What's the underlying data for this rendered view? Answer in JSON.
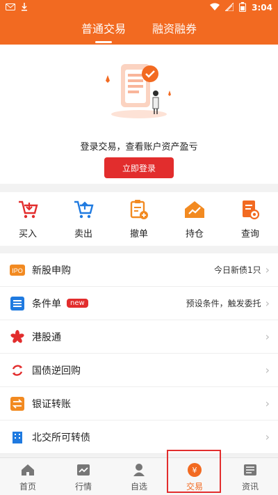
{
  "status": {
    "time": "3:04"
  },
  "tabs": [
    {
      "label": "普通交易"
    },
    {
      "label": "融资融券"
    }
  ],
  "login": {
    "message": "登录交易，查看账户资产盈亏",
    "button": "立即登录"
  },
  "actions": [
    {
      "label": "买入",
      "icon": "cart-down-icon"
    },
    {
      "label": "卖出",
      "icon": "cart-up-icon"
    },
    {
      "label": "撤单",
      "icon": "clipboard-plus-icon"
    },
    {
      "label": "持仓",
      "icon": "house-chart-icon"
    },
    {
      "label": "查询",
      "icon": "document-search-icon"
    }
  ],
  "list": [
    {
      "title": "新股申购",
      "right": "今日新债1只",
      "icon": "ipo-icon"
    },
    {
      "title": "条件单",
      "badge": "new",
      "right": "预设条件，触发委托",
      "icon": "list-icon"
    },
    {
      "title": "港股通",
      "right": "",
      "icon": "bauhinia-icon"
    },
    {
      "title": "国债逆回购",
      "right": "",
      "icon": "repo-icon"
    },
    {
      "title": "银证转账",
      "right": "",
      "icon": "transfer-icon"
    },
    {
      "title": "北交所可转债",
      "right": "",
      "icon": "building-icon"
    }
  ],
  "nav": [
    {
      "label": "首页",
      "icon": "home-icon"
    },
    {
      "label": "行情",
      "icon": "chart-icon"
    },
    {
      "label": "自选",
      "icon": "person-icon"
    },
    {
      "label": "交易",
      "icon": "yen-icon"
    },
    {
      "label": "资讯",
      "icon": "news-icon"
    }
  ],
  "colors": {
    "brand": "#f26a21",
    "accent": "#e22d2d"
  }
}
